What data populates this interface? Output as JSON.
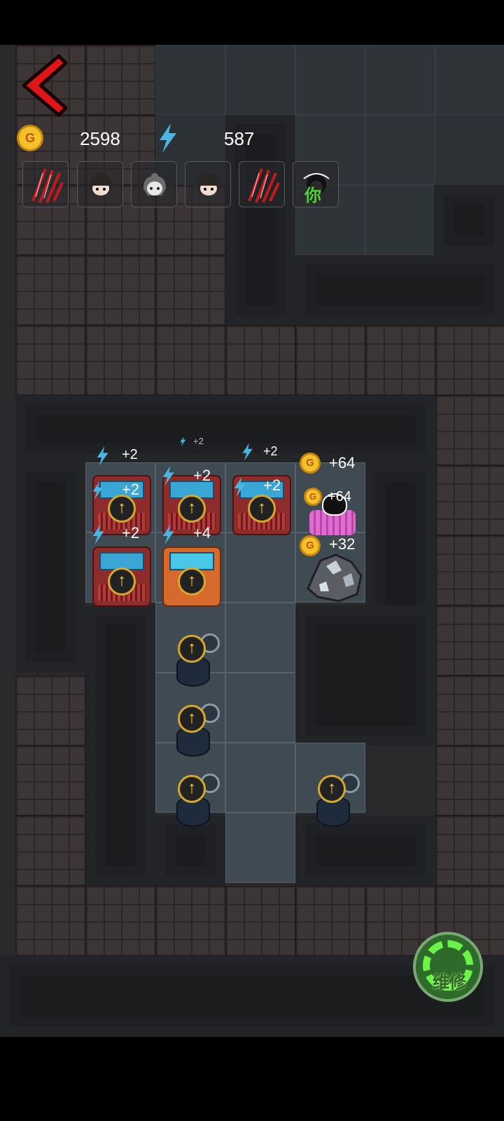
{
  "stats": {
    "coin_icon": "G",
    "coins": "2598",
    "energy": "587"
  },
  "characters": [
    {
      "icon": "claw-scratch-icon"
    },
    {
      "icon": "girl-face-icon"
    },
    {
      "icon": "grey-girl-face-icon"
    },
    {
      "icon": "girl-face-icon"
    },
    {
      "icon": "claw-scratch-icon"
    },
    {
      "icon": "player-face-icon",
      "tag": "你"
    }
  ],
  "energy_gains": {
    "row0": [
      "+2",
      "+2",
      "+2"
    ],
    "m1": "+2",
    "m2": "+2",
    "m3": "+2",
    "m4": "+2",
    "m5": "+4"
  },
  "coin_gains": {
    "bed_top": "+64",
    "bed": "+64",
    "ore": "+32"
  },
  "repair_button": {
    "label": "维修"
  },
  "colors": {
    "accent_gold": "#f2c22a",
    "energy_blue": "#4ab6e0",
    "repair_green": "#6cf24a",
    "back_red": "#e01616"
  }
}
